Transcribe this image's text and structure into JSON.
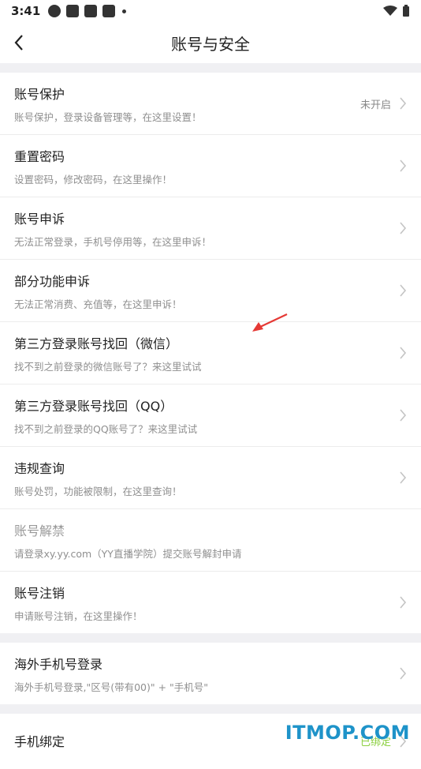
{
  "status_bar": {
    "time": "3:41"
  },
  "header": {
    "title": "账号与安全"
  },
  "group1": [
    {
      "title": "账号保护",
      "subtitle": "账号保护，登录设备管理等，在这里设置！",
      "value": "未开启"
    },
    {
      "title": "重置密码",
      "subtitle": "设置密码，修改密码，在这里操作！"
    },
    {
      "title": "账号申诉",
      "subtitle": "无法正常登录，手机号停用等，在这里申诉！"
    },
    {
      "title": "部分功能申诉",
      "subtitle": "无法正常消费、充值等，在这里申诉！"
    },
    {
      "title": "第三方登录账号找回（微信）",
      "subtitle": "找不到之前登录的微信账号了？来这里试试"
    },
    {
      "title": "第三方登录账号找回（QQ）",
      "subtitle": "找不到之前登录的QQ账号了？来这里试试"
    },
    {
      "title": "违规查询",
      "subtitle": "账号处罚，功能被限制，在这里查询！"
    },
    {
      "title": "账号解禁",
      "subtitle": "请登录xy.yy.com（YY直播学院）提交账号解封申请"
    },
    {
      "title": "账号注销",
      "subtitle": "申请账号注销，在这里操作！"
    }
  ],
  "group2": [
    {
      "title": "海外手机号登录",
      "subtitle": "海外手机号登录,\"区号(带有00)\" + \"手机号\""
    }
  ],
  "group3": [
    {
      "title": "手机绑定",
      "value": "已绑定"
    }
  ],
  "watermark": "ITMOP.COM",
  "colors": {
    "accent_arrow": "#e53935",
    "watermark": "#1e93c9"
  }
}
